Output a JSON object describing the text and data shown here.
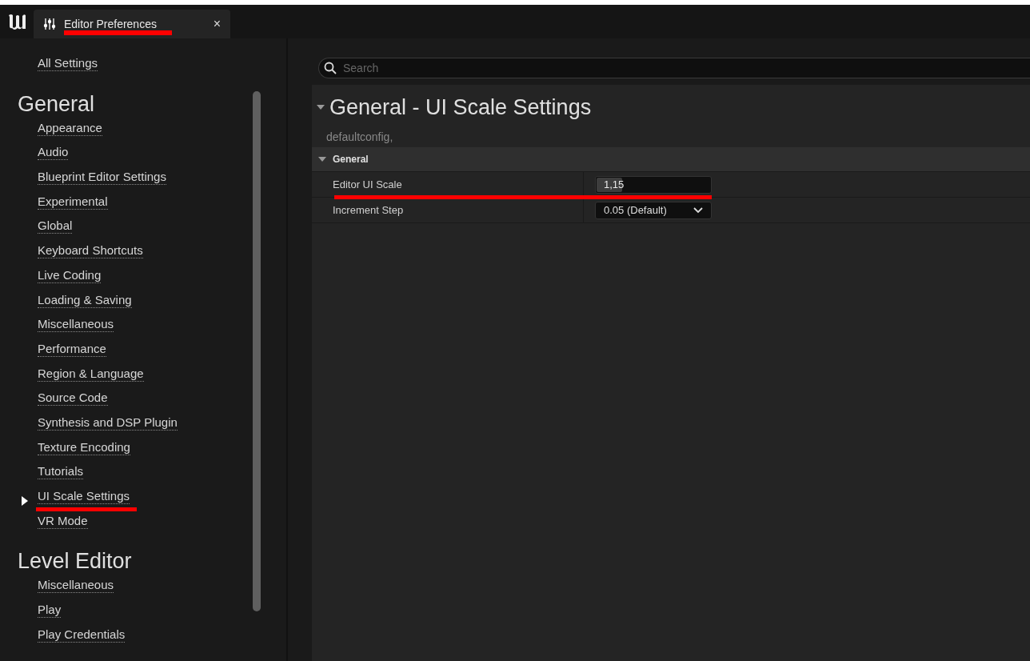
{
  "tab": {
    "title": "Editor Preferences",
    "close": "×",
    "underlined": true
  },
  "sidebar": {
    "all_settings": "All Settings",
    "sections": [
      {
        "title": "General",
        "items": [
          {
            "label": "Appearance",
            "selected": false
          },
          {
            "label": "Audio",
            "selected": false
          },
          {
            "label": "Blueprint Editor Settings",
            "selected": false
          },
          {
            "label": "Experimental",
            "selected": false
          },
          {
            "label": "Global",
            "selected": false
          },
          {
            "label": "Keyboard Shortcuts",
            "selected": false
          },
          {
            "label": "Live Coding",
            "selected": false
          },
          {
            "label": "Loading & Saving",
            "selected": false
          },
          {
            "label": "Miscellaneous",
            "selected": false
          },
          {
            "label": "Performance",
            "selected": false
          },
          {
            "label": "Region & Language",
            "selected": false
          },
          {
            "label": "Source Code",
            "selected": false
          },
          {
            "label": "Synthesis and DSP Plugin",
            "selected": false
          },
          {
            "label": "Texture Encoding",
            "selected": false
          },
          {
            "label": "Tutorials",
            "selected": false
          },
          {
            "label": "UI Scale Settings",
            "selected": true
          },
          {
            "label": "VR Mode",
            "selected": false
          }
        ]
      },
      {
        "title": "Level Editor",
        "items": [
          {
            "label": "Miscellaneous",
            "selected": false
          },
          {
            "label": "Play",
            "selected": false
          },
          {
            "label": "Play Credentials",
            "selected": false
          }
        ]
      }
    ]
  },
  "search": {
    "placeholder": "Search"
  },
  "details": {
    "title": "General - UI Scale Settings",
    "expanded": true,
    "config": "defaultconfig,",
    "category": {
      "label": "General",
      "expanded": true
    },
    "rows": [
      {
        "kind": "slider",
        "label": "Editor UI Scale",
        "value": "1,15",
        "level": 0.22,
        "underlined": true
      },
      {
        "kind": "dropdown",
        "label": "Increment Step",
        "value": "0.05  (Default)",
        "underlined": false
      }
    ]
  }
}
